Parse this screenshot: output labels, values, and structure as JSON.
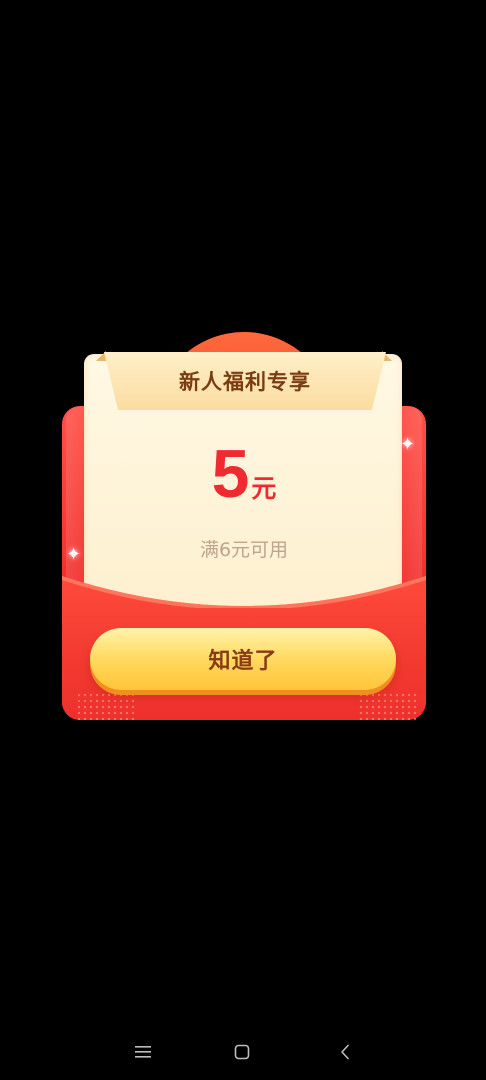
{
  "modal": {
    "title": "新人福利专享",
    "amount": "5",
    "unit": "元",
    "condition": "满6元可用",
    "confirm_label": "知道了"
  },
  "colors": {
    "envelope_red": "#f2302e",
    "amount_red": "#ef2b31",
    "button_yellow": "#ffd75a",
    "button_text": "#8a3a14",
    "title_text": "#7a3c12",
    "condition_text": "#c0a48c",
    "backdrop": "#000000"
  },
  "navbar": {
    "icons": [
      "menu-icon",
      "home-icon",
      "back-icon"
    ]
  }
}
